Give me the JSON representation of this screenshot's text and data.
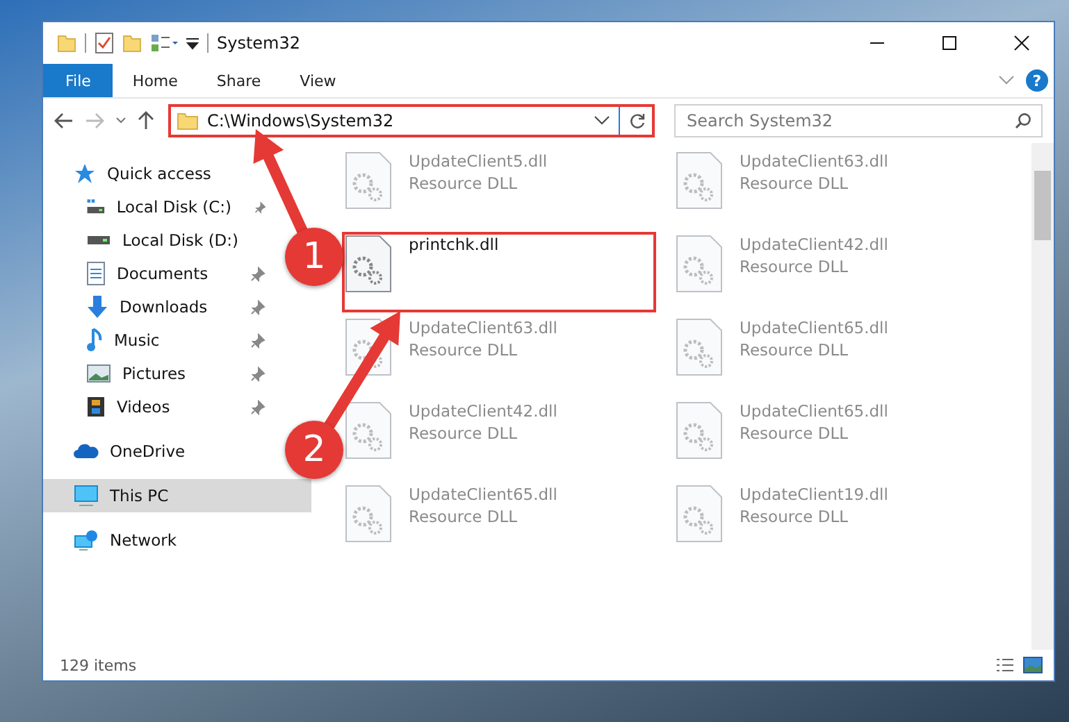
{
  "window": {
    "title": "System32"
  },
  "ribbon": {
    "tabs": [
      {
        "label": "File",
        "selected": true
      },
      {
        "label": "Home",
        "selected": false
      },
      {
        "label": "Share",
        "selected": false
      },
      {
        "label": "View",
        "selected": false
      }
    ],
    "help": "?"
  },
  "address": {
    "path": "C:\\Windows\\System32",
    "highlighted": true
  },
  "search": {
    "placeholder": "Search System32"
  },
  "sidebar": {
    "items": [
      {
        "label": "Quick access",
        "kind": "star",
        "selected": false,
        "children": [
          {
            "label": "Local Disk (C:)",
            "kind": "system-drive",
            "selected": false,
            "pinned": true
          },
          {
            "label": "Local Disk (D:)",
            "kind": "drive",
            "selected": false,
            "pinned": false
          },
          {
            "label": "Documents",
            "kind": "documents",
            "selected": false,
            "pinned": true
          },
          {
            "label": "Downloads",
            "kind": "downloads",
            "selected": false,
            "pinned": true
          },
          {
            "label": "Music",
            "kind": "music",
            "selected": false,
            "pinned": true
          },
          {
            "label": "Pictures",
            "kind": "pictures",
            "selected": false,
            "pinned": true
          },
          {
            "label": "Videos",
            "kind": "videos",
            "selected": false,
            "pinned": true
          }
        ]
      },
      {
        "label": "OneDrive",
        "kind": "cloud",
        "selected": false
      },
      {
        "label": "This PC",
        "kind": "computer",
        "selected": true
      },
      {
        "label": "Network",
        "kind": "network",
        "selected": false
      }
    ]
  },
  "files": [
    {
      "name": "UpdateClient5.dll",
      "type": "Resource DLL",
      "blurred": true,
      "highlighted": false
    },
    {
      "name": "UpdateClient63.dll",
      "type": "Resource DLL",
      "blurred": true,
      "highlighted": false
    },
    {
      "name": "printchk.dll",
      "blurred": false,
      "highlighted": true
    },
    {
      "name": "UpdateClient42.dll",
      "type": "Resource DLL",
      "blurred": true,
      "highlighted": false
    },
    {
      "name": "UpdateClient63.dll",
      "type": "Resource DLL",
      "blurred": true,
      "highlighted": false
    },
    {
      "name": "UpdateClient65.dll",
      "type": "Resource DLL",
      "blurred": true,
      "highlighted": false
    },
    {
      "name": "UpdateClient42.dll",
      "type": "Resource DLL",
      "blurred": true,
      "highlighted": false
    },
    {
      "name": "UpdateClient65.dll",
      "type": "Resource DLL",
      "blurred": true,
      "highlighted": false
    },
    {
      "name": "UpdateClient65.dll",
      "type": "Resource DLL",
      "blurred": true,
      "highlighted": false
    },
    {
      "name": "UpdateClient19.dll",
      "type": "Resource DLL",
      "blurred": true,
      "highlighted": false
    }
  ],
  "status_bar": {
    "count": "129 items"
  },
  "annotations": [
    {
      "number": "1"
    },
    {
      "number": "2"
    }
  ]
}
